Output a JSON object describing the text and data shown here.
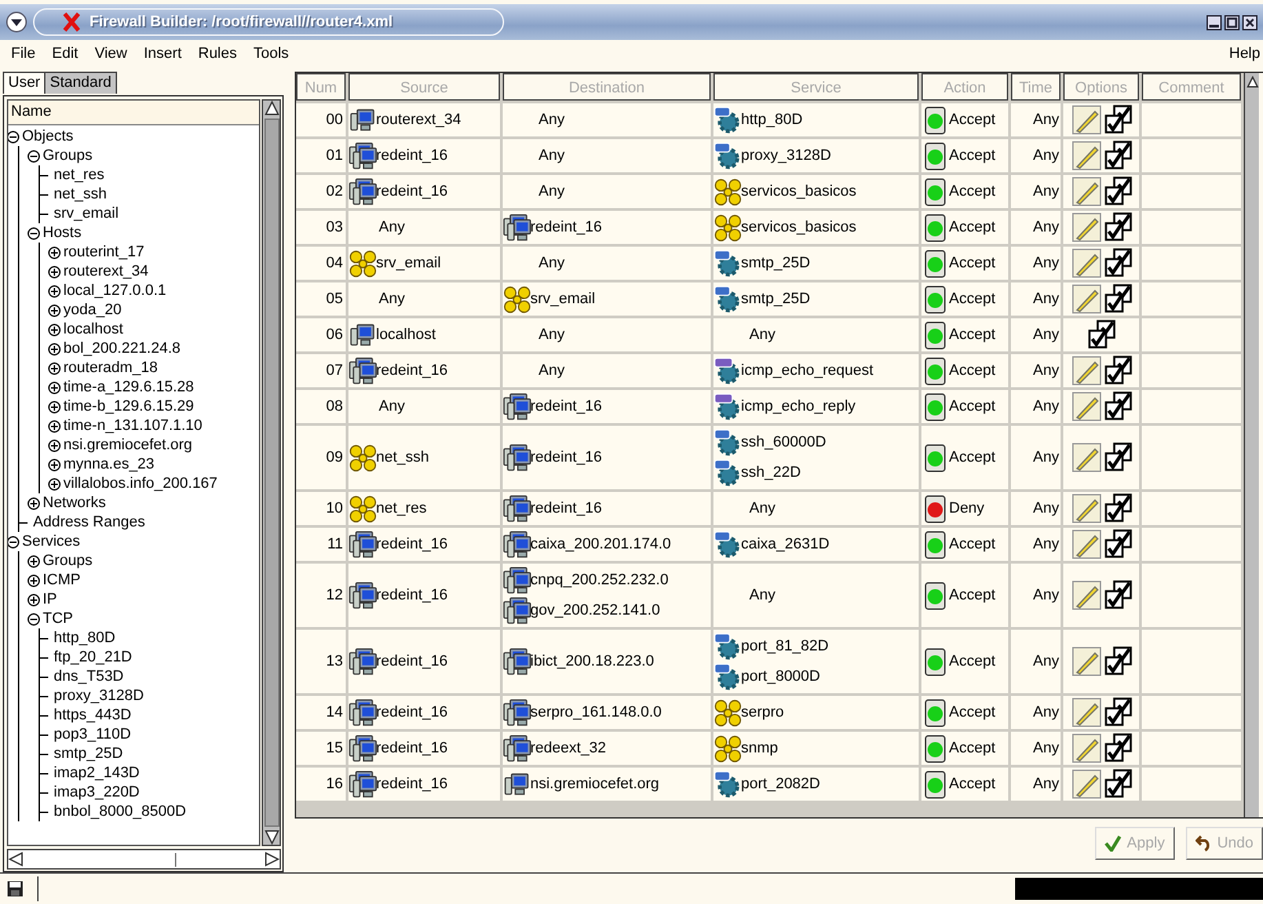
{
  "window": {
    "title": "Firewall Builder: /root/firewall//router4.xml"
  },
  "menu": [
    "File",
    "Edit",
    "View",
    "Insert",
    "Rules",
    "Tools"
  ],
  "menu_right": "Help",
  "tree_tabs": [
    {
      "label": "User",
      "selected": true
    },
    {
      "label": "Standard",
      "selected": false
    }
  ],
  "tree": {
    "header": "Name",
    "items": [
      {
        "label": "Objects",
        "expanded": true,
        "children": [
          {
            "label": "Groups",
            "expanded": true,
            "children": [
              {
                "label": "net_res"
              },
              {
                "label": "net_ssh"
              },
              {
                "label": "srv_email"
              }
            ]
          },
          {
            "label": "Hosts",
            "expanded": true,
            "children": [
              {
                "label": "routerint_17",
                "expanded": false
              },
              {
                "label": "routerext_34",
                "expanded": false
              },
              {
                "label": "local_127.0.0.1",
                "expanded": false
              },
              {
                "label": "yoda_20",
                "expanded": false
              },
              {
                "label": "localhost",
                "expanded": false
              },
              {
                "label": "bol_200.221.24.8",
                "expanded": false
              },
              {
                "label": "routeradm_18",
                "expanded": false
              },
              {
                "label": "time-a_129.6.15.28",
                "expanded": false
              },
              {
                "label": "time-b_129.6.15.29",
                "expanded": false
              },
              {
                "label": "time-n_131.107.1.10",
                "expanded": false
              },
              {
                "label": "nsi.gremiocefet.org",
                "expanded": false
              },
              {
                "label": "mynna.es_23",
                "expanded": false
              },
              {
                "label": "villalobos.info_200.167",
                "expanded": false
              }
            ]
          },
          {
            "label": "Networks",
            "expanded": false
          },
          {
            "label": "Address Ranges"
          }
        ]
      },
      {
        "label": "Services",
        "expanded": true,
        "children": [
          {
            "label": "Groups",
            "expanded": false
          },
          {
            "label": "ICMP",
            "expanded": false
          },
          {
            "label": "IP",
            "expanded": false
          },
          {
            "label": "TCP",
            "expanded": true,
            "children": [
              {
                "label": "http_80D"
              },
              {
                "label": "ftp_20_21D"
              },
              {
                "label": "dns_T53D"
              },
              {
                "label": "proxy_3128D"
              },
              {
                "label": "https_443D"
              },
              {
                "label": "pop3_110D"
              },
              {
                "label": "smtp_25D"
              },
              {
                "label": "imap2_143D"
              },
              {
                "label": "imap3_220D"
              },
              {
                "label": "bnbol_8000_8500D"
              }
            ]
          }
        ]
      }
    ]
  },
  "table": {
    "columns": [
      "Num",
      "Source",
      "Destination",
      "Service",
      "Action",
      "Time",
      "Options",
      "Comment"
    ],
    "rows": [
      {
        "num": "00",
        "source": [
          {
            "kind": "host",
            "label": "routerext_34"
          }
        ],
        "destination": [
          {
            "kind": "any",
            "label": "Any"
          }
        ],
        "service": [
          {
            "kind": "tcp",
            "label": "http_80D"
          }
        ],
        "action": {
          "kind": "accept",
          "label": "Accept"
        },
        "time": "Any",
        "log": true
      },
      {
        "num": "01",
        "source": [
          {
            "kind": "network",
            "label": "redeint_16"
          }
        ],
        "destination": [
          {
            "kind": "any",
            "label": "Any"
          }
        ],
        "service": [
          {
            "kind": "tcp",
            "label": "proxy_3128D"
          }
        ],
        "action": {
          "kind": "accept",
          "label": "Accept"
        },
        "time": "Any",
        "log": true
      },
      {
        "num": "02",
        "source": [
          {
            "kind": "network",
            "label": "redeint_16"
          }
        ],
        "destination": [
          {
            "kind": "any",
            "label": "Any"
          }
        ],
        "service": [
          {
            "kind": "group",
            "label": "servicos_basicos"
          }
        ],
        "action": {
          "kind": "accept",
          "label": "Accept"
        },
        "time": "Any",
        "log": true
      },
      {
        "num": "03",
        "source": [
          {
            "kind": "any",
            "label": "Any"
          }
        ],
        "destination": [
          {
            "kind": "network",
            "label": "redeint_16"
          }
        ],
        "service": [
          {
            "kind": "group",
            "label": "servicos_basicos"
          }
        ],
        "action": {
          "kind": "accept",
          "label": "Accept"
        },
        "time": "Any",
        "log": true
      },
      {
        "num": "04",
        "source": [
          {
            "kind": "group",
            "label": "srv_email"
          }
        ],
        "destination": [
          {
            "kind": "any",
            "label": "Any"
          }
        ],
        "service": [
          {
            "kind": "tcp",
            "label": "smtp_25D"
          }
        ],
        "action": {
          "kind": "accept",
          "label": "Accept"
        },
        "time": "Any",
        "log": true
      },
      {
        "num": "05",
        "source": [
          {
            "kind": "any",
            "label": "Any"
          }
        ],
        "destination": [
          {
            "kind": "group",
            "label": "srv_email"
          }
        ],
        "service": [
          {
            "kind": "tcp",
            "label": "smtp_25D"
          }
        ],
        "action": {
          "kind": "accept",
          "label": "Accept"
        },
        "time": "Any",
        "log": true
      },
      {
        "num": "06",
        "source": [
          {
            "kind": "host",
            "label": "localhost"
          }
        ],
        "destination": [
          {
            "kind": "any",
            "label": "Any"
          }
        ],
        "service": [
          {
            "kind": "any",
            "label": "Any"
          }
        ],
        "action": {
          "kind": "accept",
          "label": "Accept"
        },
        "time": "Any",
        "log": false
      },
      {
        "num": "07",
        "source": [
          {
            "kind": "network",
            "label": "redeint_16"
          }
        ],
        "destination": [
          {
            "kind": "any",
            "label": "Any"
          }
        ],
        "service": [
          {
            "kind": "icmp",
            "label": "icmp_echo_request"
          }
        ],
        "action": {
          "kind": "accept",
          "label": "Accept"
        },
        "time": "Any",
        "log": true
      },
      {
        "num": "08",
        "source": [
          {
            "kind": "any",
            "label": "Any"
          }
        ],
        "destination": [
          {
            "kind": "network",
            "label": "redeint_16"
          }
        ],
        "service": [
          {
            "kind": "icmp",
            "label": "icmp_echo_reply"
          }
        ],
        "action": {
          "kind": "accept",
          "label": "Accept"
        },
        "time": "Any",
        "log": true
      },
      {
        "num": "09",
        "source": [
          {
            "kind": "group",
            "label": "net_ssh"
          }
        ],
        "destination": [
          {
            "kind": "network",
            "label": "redeint_16"
          }
        ],
        "service": [
          {
            "kind": "tcp",
            "label": "ssh_60000D"
          },
          {
            "kind": "tcp",
            "label": "ssh_22D"
          }
        ],
        "action": {
          "kind": "accept",
          "label": "Accept"
        },
        "time": "Any",
        "log": true
      },
      {
        "num": "10",
        "source": [
          {
            "kind": "group",
            "label": "net_res"
          }
        ],
        "destination": [
          {
            "kind": "network",
            "label": "redeint_16"
          }
        ],
        "service": [
          {
            "kind": "any",
            "label": "Any"
          }
        ],
        "action": {
          "kind": "deny",
          "label": "Deny"
        },
        "time": "Any",
        "log": true
      },
      {
        "num": "11",
        "source": [
          {
            "kind": "network",
            "label": "redeint_16"
          }
        ],
        "destination": [
          {
            "kind": "network",
            "label": "caixa_200.201.174.0"
          }
        ],
        "service": [
          {
            "kind": "tcp",
            "label": "caixa_2631D"
          }
        ],
        "action": {
          "kind": "accept",
          "label": "Accept"
        },
        "time": "Any",
        "log": true
      },
      {
        "num": "12",
        "source": [
          {
            "kind": "network",
            "label": "redeint_16"
          }
        ],
        "destination": [
          {
            "kind": "network",
            "label": "cnpq_200.252.232.0"
          },
          {
            "kind": "network",
            "label": "gov_200.252.141.0"
          }
        ],
        "service": [
          {
            "kind": "any",
            "label": "Any"
          }
        ],
        "action": {
          "kind": "accept",
          "label": "Accept"
        },
        "time": "Any",
        "log": true
      },
      {
        "num": "13",
        "source": [
          {
            "kind": "network",
            "label": "redeint_16"
          }
        ],
        "destination": [
          {
            "kind": "network",
            "label": "ibict_200.18.223.0"
          }
        ],
        "service": [
          {
            "kind": "tcp",
            "label": "port_81_82D"
          },
          {
            "kind": "tcp",
            "label": "port_8000D"
          }
        ],
        "action": {
          "kind": "accept",
          "label": "Accept"
        },
        "time": "Any",
        "log": true
      },
      {
        "num": "14",
        "source": [
          {
            "kind": "network",
            "label": "redeint_16"
          }
        ],
        "destination": [
          {
            "kind": "network",
            "label": "serpro_161.148.0.0"
          }
        ],
        "service": [
          {
            "kind": "group",
            "label": "serpro"
          }
        ],
        "action": {
          "kind": "accept",
          "label": "Accept"
        },
        "time": "Any",
        "log": true
      },
      {
        "num": "15",
        "source": [
          {
            "kind": "network",
            "label": "redeint_16"
          }
        ],
        "destination": [
          {
            "kind": "network",
            "label": "redeext_32"
          }
        ],
        "service": [
          {
            "kind": "group",
            "label": "snmp"
          }
        ],
        "action": {
          "kind": "accept",
          "label": "Accept"
        },
        "time": "Any",
        "log": true
      },
      {
        "num": "16",
        "source": [
          {
            "kind": "network",
            "label": "redeint_16"
          }
        ],
        "destination": [
          {
            "kind": "host",
            "label": "nsi.gremiocefet.org"
          }
        ],
        "service": [
          {
            "kind": "tcp",
            "label": "port_2082D"
          }
        ],
        "action": {
          "kind": "accept",
          "label": "Accept"
        },
        "time": "Any",
        "log": true
      }
    ]
  },
  "buttons": [
    {
      "kind": "apply",
      "label": "Apply",
      "disabled": true
    },
    {
      "kind": "undo",
      "label": "Undo",
      "disabled": true
    }
  ]
}
